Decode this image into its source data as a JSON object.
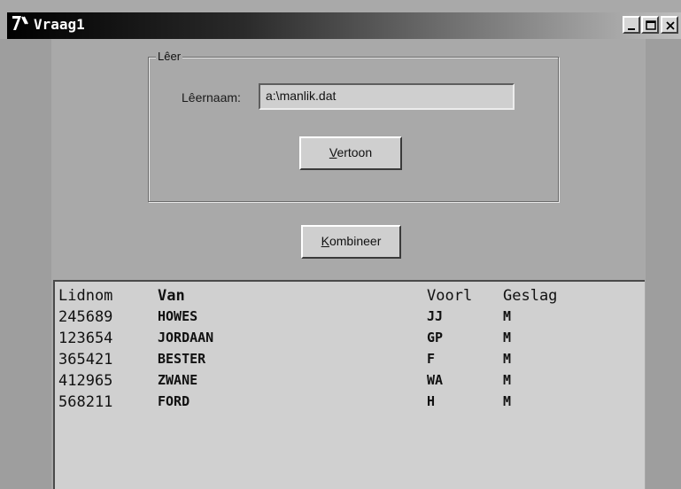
{
  "window": {
    "title": "Vraag1",
    "icon": "app-icon",
    "controls": [
      "minimize-icon",
      "maximize-icon",
      "close-icon"
    ]
  },
  "file_group": {
    "title": "Lêer",
    "field_label": "Lêernaam:",
    "field_value": "a:\\manlik.dat",
    "show_button": "Vertoon"
  },
  "combine_button": "Kombineer",
  "list": {
    "headers": [
      "Lidnom",
      "Van",
      "Voorl",
      "Geslag"
    ],
    "rows": [
      [
        "245689",
        "HOWES",
        "JJ",
        "M"
      ],
      [
        "123654",
        "JORDAAN",
        "GP",
        "M"
      ],
      [
        "365421",
        "BESTER",
        "F",
        "M"
      ],
      [
        "412965",
        "ZWANE",
        "WA",
        "M"
      ],
      [
        "568211",
        "FORD",
        "H",
        "M"
      ]
    ]
  },
  "colors": {
    "background": "#a9a9a9",
    "control": "#cfcfcf",
    "titlebar_start": "#000000",
    "titlebar_end": "#bdbdbd"
  }
}
